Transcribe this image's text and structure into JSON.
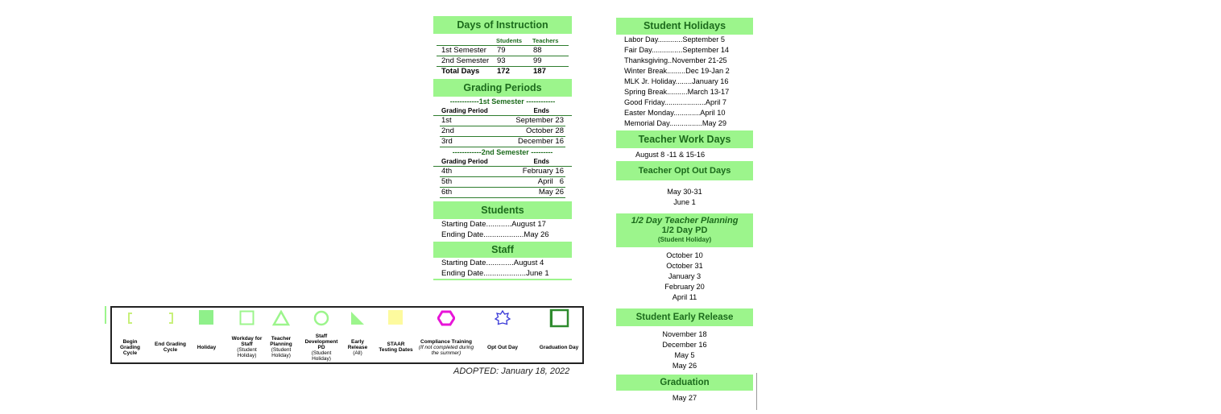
{
  "instruction": {
    "title": "Days of Instruction",
    "col_students": "Students",
    "col_teachers": "Teachers",
    "rows": [
      {
        "label": "1st Semester",
        "students": "79",
        "teachers": "88"
      },
      {
        "label": "2nd Semester",
        "students": "93",
        "teachers": "99"
      },
      {
        "label": "Total Days",
        "students": "172",
        "teachers": "187"
      }
    ]
  },
  "grading": {
    "title": "Grading Periods",
    "sem1": "------------1st Semester ------------",
    "sem2": "------------2nd Semester ---------",
    "col_period": "Grading Period",
    "col_ends": "Ends",
    "sem1_rows": [
      {
        "p": "1st",
        "e": "September 23"
      },
      {
        "p": "2nd",
        "e": "October 28"
      },
      {
        "p": "3rd",
        "e": "December 16"
      }
    ],
    "sem2_rows": [
      {
        "p": "4th",
        "e": "February 16"
      },
      {
        "p": "5th",
        "e": "April   6"
      },
      {
        "p": "6th",
        "e": "May 26"
      }
    ]
  },
  "students": {
    "title": "Students",
    "start": "Starting Date............August 17",
    "end": "Ending Date...................May 26"
  },
  "staff": {
    "title": "Staff",
    "start": "Starting Date.............August  4",
    "end": "Ending Date....................June 1"
  },
  "holidays": {
    "title": "Student Holidays",
    "items": [
      "Labor Day............September 5",
      "Fair Day...............September 14",
      "Thanksgiving..November 21-25",
      "Winter Break.........Dec 19-Jan 2",
      "MLK Jr. Holiday........January 16",
      "Spring Break..........March 13-17",
      "Good Friday....................April 7",
      "Easter Monday.............April 10",
      "Memorial Day................May 29"
    ]
  },
  "workdays": {
    "title": "Teacher Work Days",
    "text": "August 8 -11 & 15-16"
  },
  "optout": {
    "title": "Teacher Opt Out Days",
    "items": [
      "May 30-31",
      "June 1"
    ]
  },
  "halfday": {
    "title1": "1/2 Day Teacher Planning",
    "title2": "1/2 Day PD",
    "title3": "(Student Holiday)",
    "items": [
      "October 10",
      "October 31",
      "January 3",
      "February 20",
      "April 11"
    ]
  },
  "early": {
    "title": "Student Early Release",
    "items": [
      "November 18",
      "December 16",
      "May 5",
      "May 26"
    ]
  },
  "graduation": {
    "title": "Graduation",
    "date": "May 27"
  },
  "legend": [
    {
      "icon": "begin-bracket",
      "label": "Begin Grading Cycle",
      "note": ""
    },
    {
      "icon": "end-bracket",
      "label": "End Grading Cycle",
      "note": ""
    },
    {
      "icon": "filled-square",
      "label": "Holiday",
      "note": ""
    },
    {
      "icon": "outline-square",
      "label": "Workday for Staff",
      "note": "(Student Holiday)"
    },
    {
      "icon": "triangle",
      "label": "Teacher Planning",
      "note": "(Student Holiday)"
    },
    {
      "icon": "circle",
      "label": "Staff Development PD",
      "note": "(Student Holiday)"
    },
    {
      "icon": "right-triangle",
      "label": "Early Release",
      "note": "(All)"
    },
    {
      "icon": "yellow-square",
      "label": "STAAR Testing Dates",
      "note": ""
    },
    {
      "icon": "hexagon",
      "label": "Compliance Training",
      "note": "(If not completed during the summer)"
    },
    {
      "icon": "star",
      "label": "Opt Out Day",
      "note": ""
    },
    {
      "icon": "graduation-square",
      "label": "Graduation Day",
      "note": ""
    }
  ],
  "adopted": "ADOPTED:  January 18, 2022",
  "colors": {
    "header": "#9cf58c",
    "header_text": "#1c6b1c",
    "hexagon": "#e815d8",
    "star": "#3a3ad8"
  }
}
